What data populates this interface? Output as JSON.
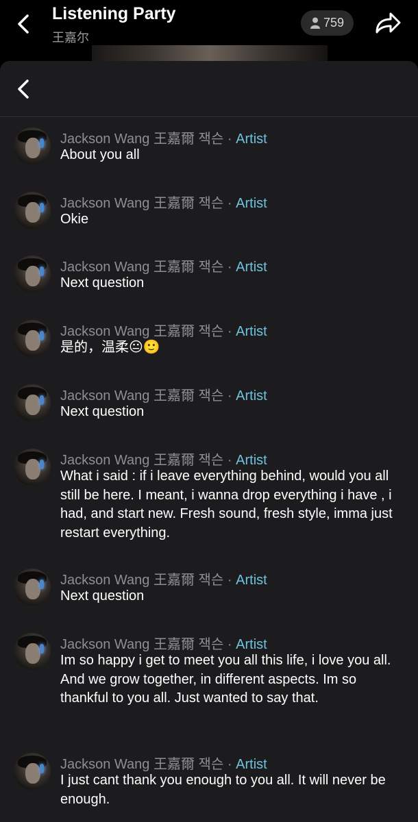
{
  "header": {
    "title": "Listening Party",
    "subtitle": "王嘉尔",
    "listener_count": "759"
  },
  "messages": [
    {
      "author": "Jackson Wang 王嘉爾 잭슨",
      "separator": "·",
      "role": "Artist",
      "text": "About you all"
    },
    {
      "author": "Jackson Wang 王嘉爾 잭슨",
      "separator": "·",
      "role": "Artist",
      "text": "Okie"
    },
    {
      "author": "Jackson Wang 王嘉爾 잭슨",
      "separator": "·",
      "role": "Artist",
      "text": "Next question"
    },
    {
      "author": "Jackson Wang 王嘉爾 잭슨",
      "separator": "·",
      "role": "Artist",
      "text": "是的，温柔😐🙂"
    },
    {
      "author": "Jackson Wang 王嘉爾 잭슨",
      "separator": "·",
      "role": "Artist",
      "text": "Next question"
    },
    {
      "author": "Jackson Wang 王嘉爾 잭슨",
      "separator": "·",
      "role": "Artist",
      "text": "What i said : if i leave everything behind, would you all still be here. I meant, i wanna drop everything i have , i had, and start new. Fresh sound, fresh style, imma just restart everything."
    },
    {
      "author": "Jackson Wang 王嘉爾 잭슨",
      "separator": "·",
      "role": "Artist",
      "text": "Next question"
    },
    {
      "author": "Jackson Wang 王嘉爾 잭슨",
      "separator": "·",
      "role": "Artist",
      "text": "Im so happy i get to meet you all this life, i love you all. And we grow together, in different aspects. Im so thankful to you all. Just wanted to say that."
    },
    {
      "author": "Jackson Wang 王嘉爾 잭슨",
      "separator": "·",
      "role": "Artist",
      "text": "I just cant thank you enough to you all. It will never be enough."
    }
  ]
}
